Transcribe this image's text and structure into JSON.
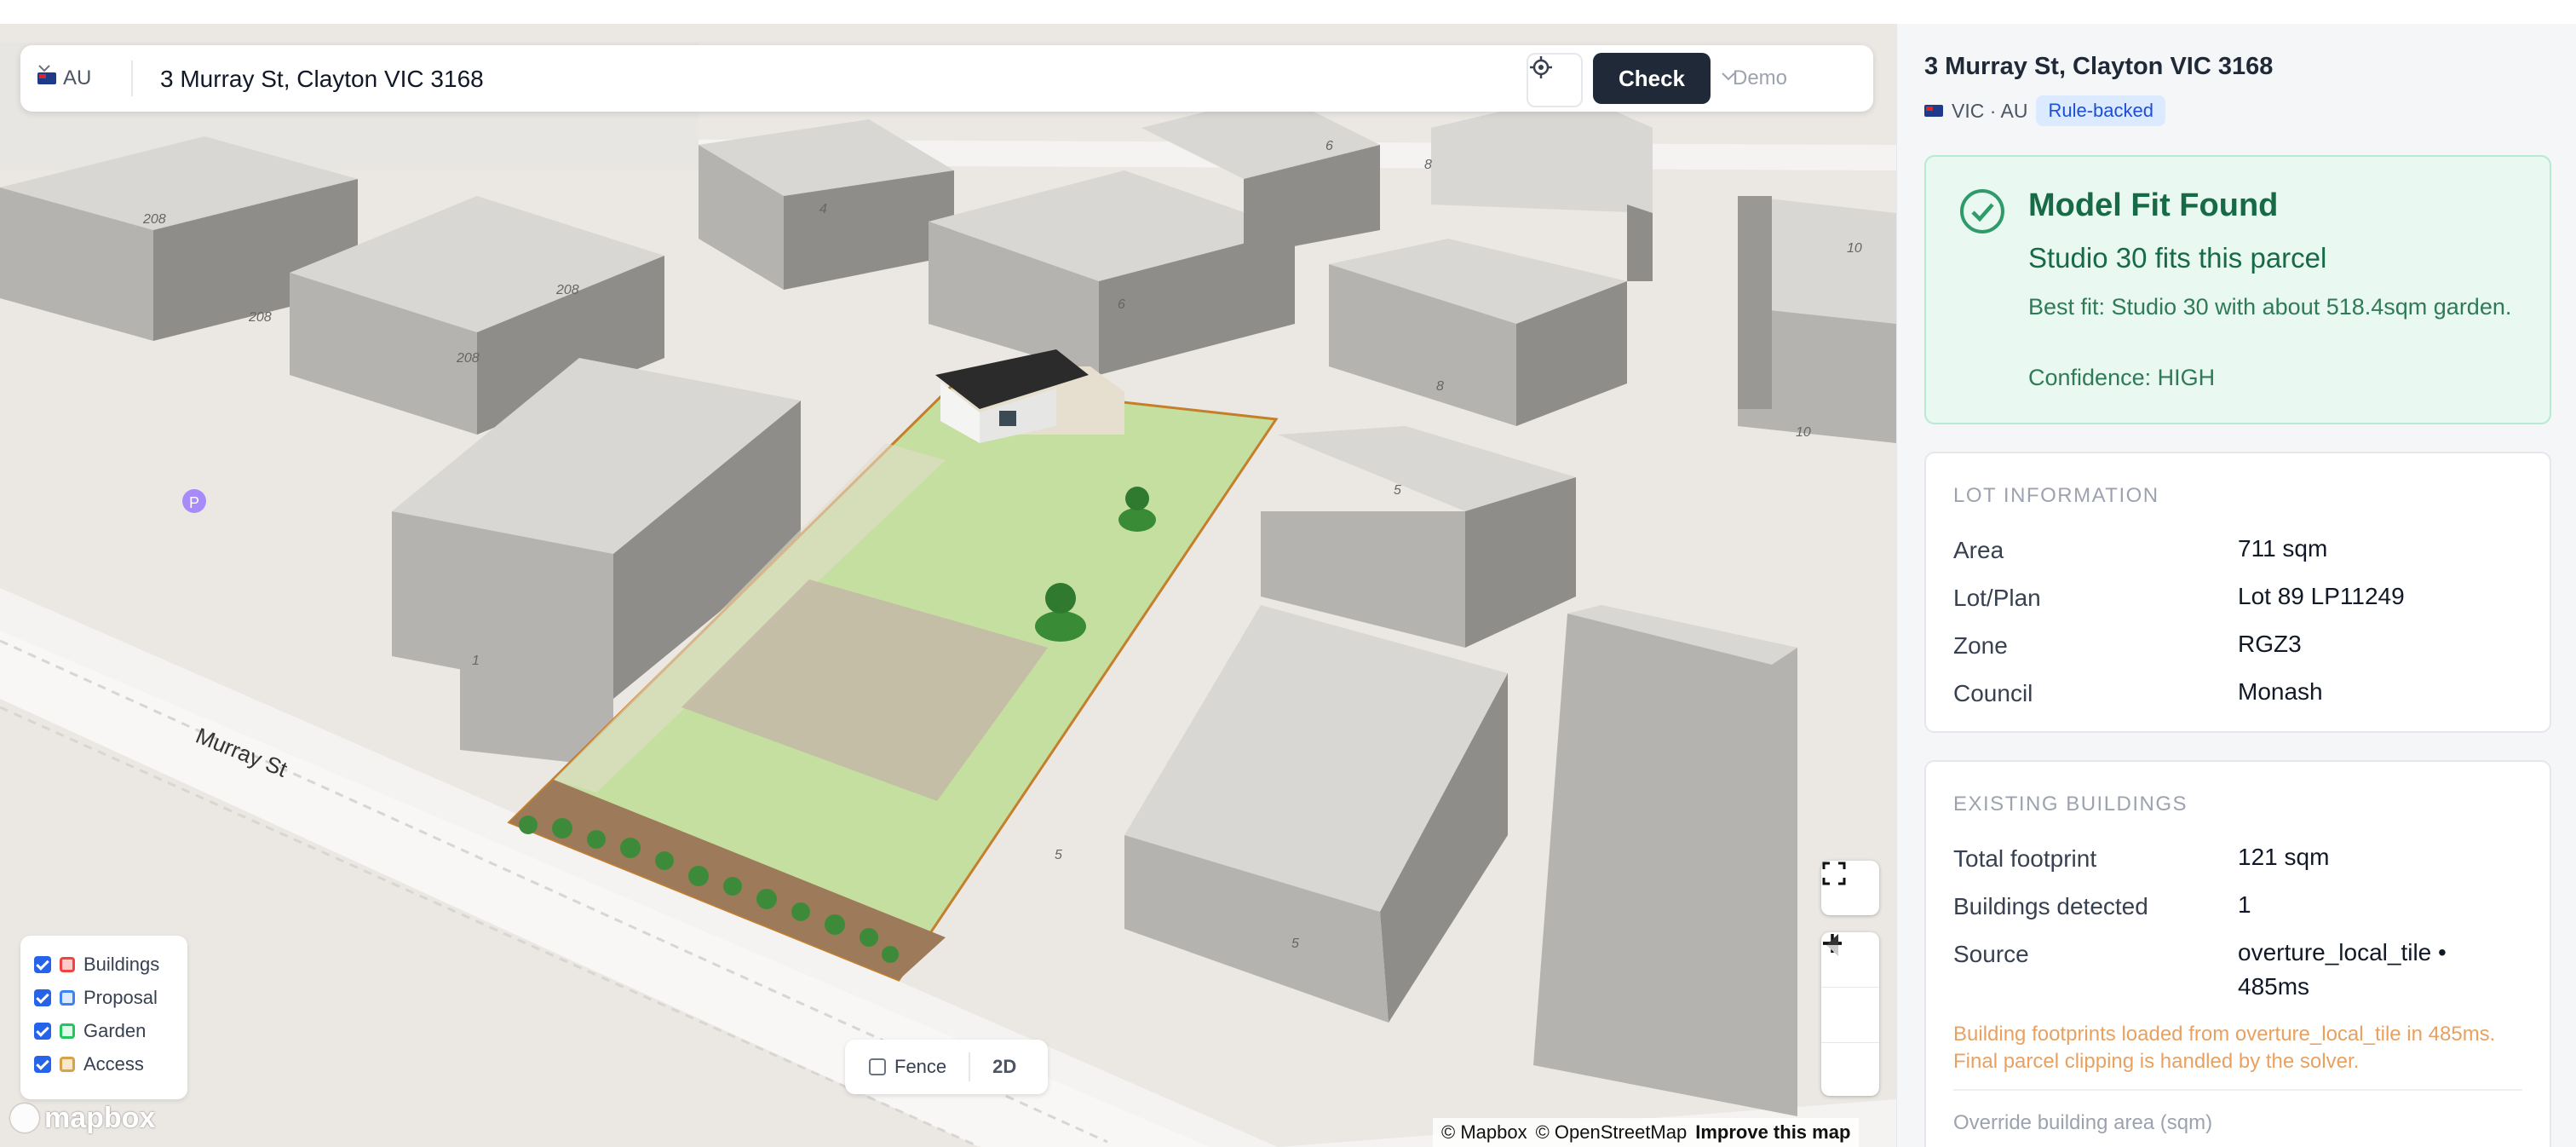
{
  "search": {
    "country_code": "AU",
    "address_value": "3 Murray St, Clayton VIC 3168",
    "check_label": "Check",
    "demo_label": "Demo"
  },
  "map": {
    "street_label": "Murray St",
    "street_numbers": [
      "208",
      "208",
      "208",
      "208",
      "4",
      "6",
      "6",
      "8",
      "8",
      "10",
      "10",
      "5",
      "5",
      "5",
      "1"
    ],
    "legend": [
      {
        "label": "Buildings",
        "color": "#ef4444",
        "checked": true
      },
      {
        "label": "Proposal",
        "color": "#3b82f6",
        "checked": true
      },
      {
        "label": "Garden",
        "color": "#22c55e",
        "checked": true
      },
      {
        "label": "Access",
        "color": "#d6a24a",
        "checked": true
      }
    ],
    "fence_label": "Fence",
    "view_toggle_label": "2D",
    "logo_text": "mapbox",
    "attribution": {
      "mapbox": "© Mapbox",
      "osm": "© OpenStreetMap",
      "improve": "Improve this map"
    }
  },
  "sidebar": {
    "address": "3 Murray St, Clayton VIC 3168",
    "region": "VIC · AU",
    "badge": "Rule-backed",
    "fit": {
      "title": "Model Fit Found",
      "subtitle": "Studio 30 fits this parcel",
      "description": "Best fit: Studio 30 with about 518.4sqm garden.",
      "confidence": "Confidence: HIGH"
    },
    "lot": {
      "heading": "LOT INFORMATION",
      "rows": [
        {
          "label": "Area",
          "value": "711 sqm"
        },
        {
          "label": "Lot/Plan",
          "value": "Lot 89 LP11249"
        },
        {
          "label": "Zone",
          "value": "RGZ3"
        },
        {
          "label": "Council",
          "value": "Monash"
        }
      ]
    },
    "existing": {
      "heading": "EXISTING BUILDINGS",
      "rows": [
        {
          "label": "Total footprint",
          "value": "121 sqm"
        },
        {
          "label": "Buildings detected",
          "value": "1"
        },
        {
          "label": "Source",
          "value": "overture_local_tile • 485ms"
        }
      ],
      "note": "Building footprints loaded from overture_local_tile in 485ms. Final parcel clipping is handled by the solver.",
      "override_label": "Override building area (sqm)"
    }
  }
}
